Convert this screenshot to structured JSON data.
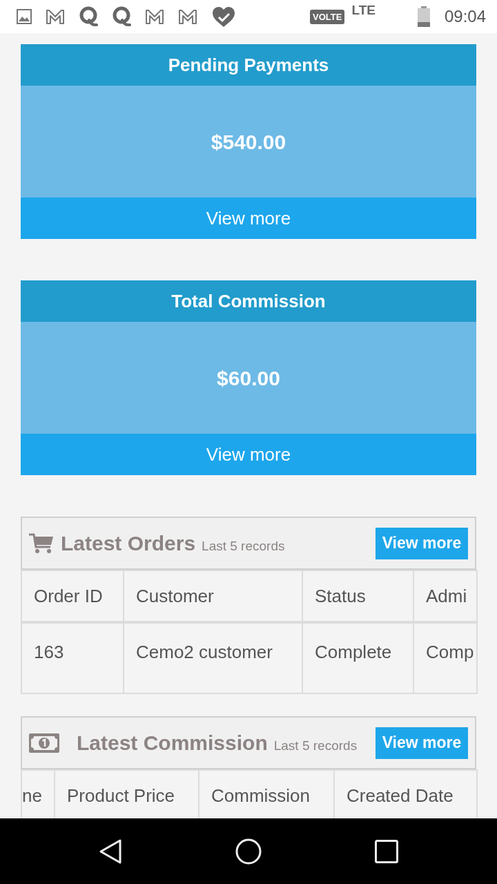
{
  "status_bar": {
    "network_badge": "VOLTE",
    "network": "LTE",
    "time": "09:04"
  },
  "summary_cards": [
    {
      "title": "Pending Payments",
      "amount": "$540.00",
      "link": "View more"
    },
    {
      "title": "Total Commission",
      "amount": "$60.00",
      "link": "View more"
    }
  ],
  "panels": [
    {
      "kind": "orders",
      "title": "Latest Orders",
      "subtitle": "Last 5 records",
      "button": "View more",
      "table": {
        "columns": [
          "Order ID",
          "Customer",
          "Status",
          "Admi"
        ],
        "rows": [
          [
            "163",
            "Cemo2 customer",
            "Complete",
            "Comp"
          ]
        ]
      }
    },
    {
      "kind": "commission",
      "title": "Latest Commission",
      "subtitle": "Last 5 records",
      "button": "View more",
      "table": {
        "columns": [
          "ne",
          "Product Price",
          "Commission",
          "Created Date"
        ]
      }
    }
  ]
}
